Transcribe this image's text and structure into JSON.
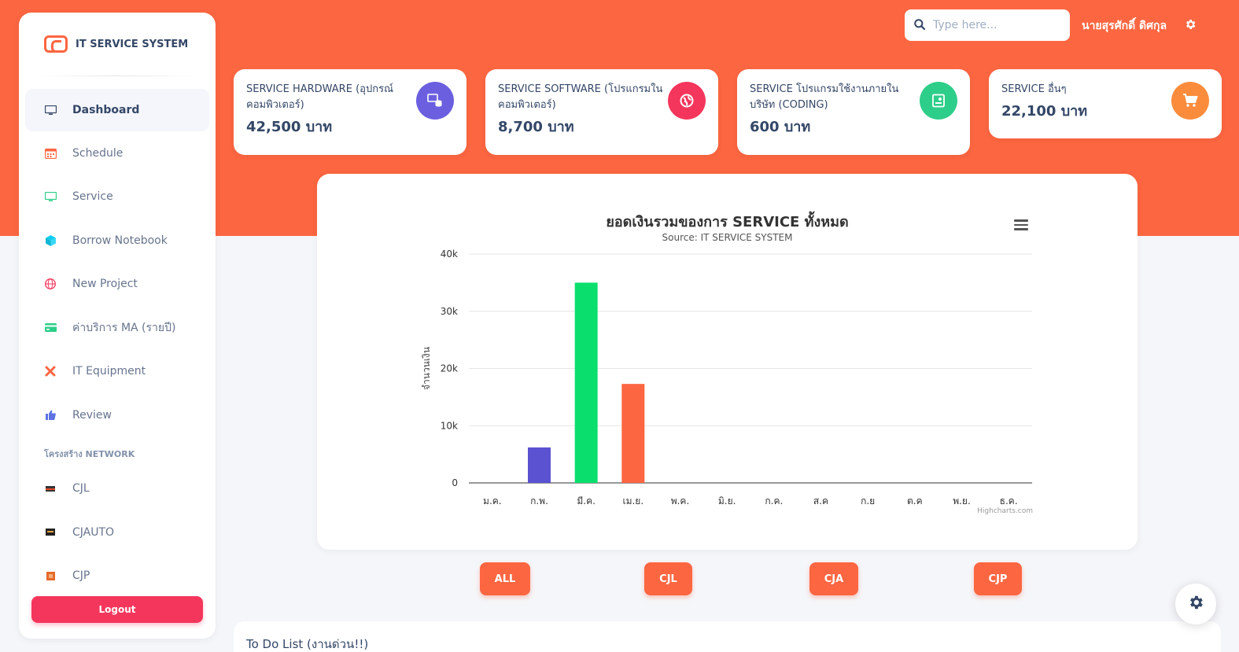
{
  "app": {
    "name": "IT SERVICE SYSTEM"
  },
  "sidebar": {
    "items": [
      {
        "label": "Dashboard",
        "icon": "monitor-icon"
      },
      {
        "label": "Schedule",
        "icon": "calendar-icon"
      },
      {
        "label": "Service",
        "icon": "desktop-icon"
      },
      {
        "label": "Borrow Notebook",
        "icon": "cube-icon"
      },
      {
        "label": "New Project",
        "icon": "globe-icon"
      },
      {
        "label": "ค่าบริการ MA (รายปี)",
        "icon": "credit-card-icon"
      },
      {
        "label": "IT Equipment",
        "icon": "tools-icon"
      },
      {
        "label": "Review",
        "icon": "thumbs-up-icon"
      }
    ],
    "section_title": "โครงสร้าง NETWORK",
    "network_items": [
      {
        "label": "CJL"
      },
      {
        "label": "CJAUTO"
      },
      {
        "label": "CJP"
      }
    ],
    "logout_label": "Logout"
  },
  "topbar": {
    "search_placeholder": "Type here...",
    "user_name": "นายสุรศักดิ์ ดิศกุล"
  },
  "cards": [
    {
      "title": "SERVICE HARDWARE (อุปกรณ์คอมพิวเตอร์)",
      "value": "42,500 บาท",
      "icon": "database-screen-icon",
      "color": "#6b5fe0"
    },
    {
      "title": "SERVICE SOFTWARE (โปรแกรมในคอมพิวเตอร์)",
      "value": "8,700 บาท",
      "icon": "globe-icon",
      "color": "#f5365c"
    },
    {
      "title": "SERVICE โปรแกรมใช้งานภายในบริษัท (CODING)",
      "value": "600 บาท",
      "icon": "code-file-icon",
      "color": "#2dce89"
    },
    {
      "title": "SERVICE อื่นๆ",
      "value": "22,100 บาท",
      "icon": "cart-icon",
      "color": "#fb8c3c"
    }
  ],
  "chart_data": {
    "type": "bar",
    "title": "ยอดเงินรวมของการ SERVICE ทั้งหมด",
    "subtitle": "Source: IT SERVICE SYSTEM",
    "ylabel": "จำนวนเงิน",
    "xlabel": "",
    "categories": [
      "ม.ค.",
      "ก.พ.",
      "มี.ค.",
      "เม.ย.",
      "พ.ค.",
      "มิ.ย.",
      "ก.ค.",
      "ส.ค",
      "ก.ย",
      "ต.ค",
      "พ.ย.",
      "ธ.ค."
    ],
    "values": [
      0,
      6200,
      35000,
      17300,
      0,
      0,
      0,
      0,
      0,
      0,
      0,
      0
    ],
    "bar_colors": [
      "#5a52d0",
      "#5a52d0",
      "#0adf6e",
      "#fc6641",
      "#5a52d0",
      "#5a52d0",
      "#5a52d0",
      "#5a52d0",
      "#5a52d0",
      "#5a52d0",
      "#5a52d0",
      "#5a52d0"
    ],
    "ylim": [
      0,
      40000
    ],
    "yticks": [
      0,
      10000,
      20000,
      30000,
      40000
    ],
    "ytick_labels": [
      "0",
      "10k",
      "20k",
      "30k",
      "40k"
    ],
    "grid": true,
    "credits": "Highcharts.com"
  },
  "filters": [
    "ALL",
    "CJL",
    "CJA",
    "CJP"
  ],
  "todo": {
    "title": "To Do List (งานด่วน!!)"
  }
}
